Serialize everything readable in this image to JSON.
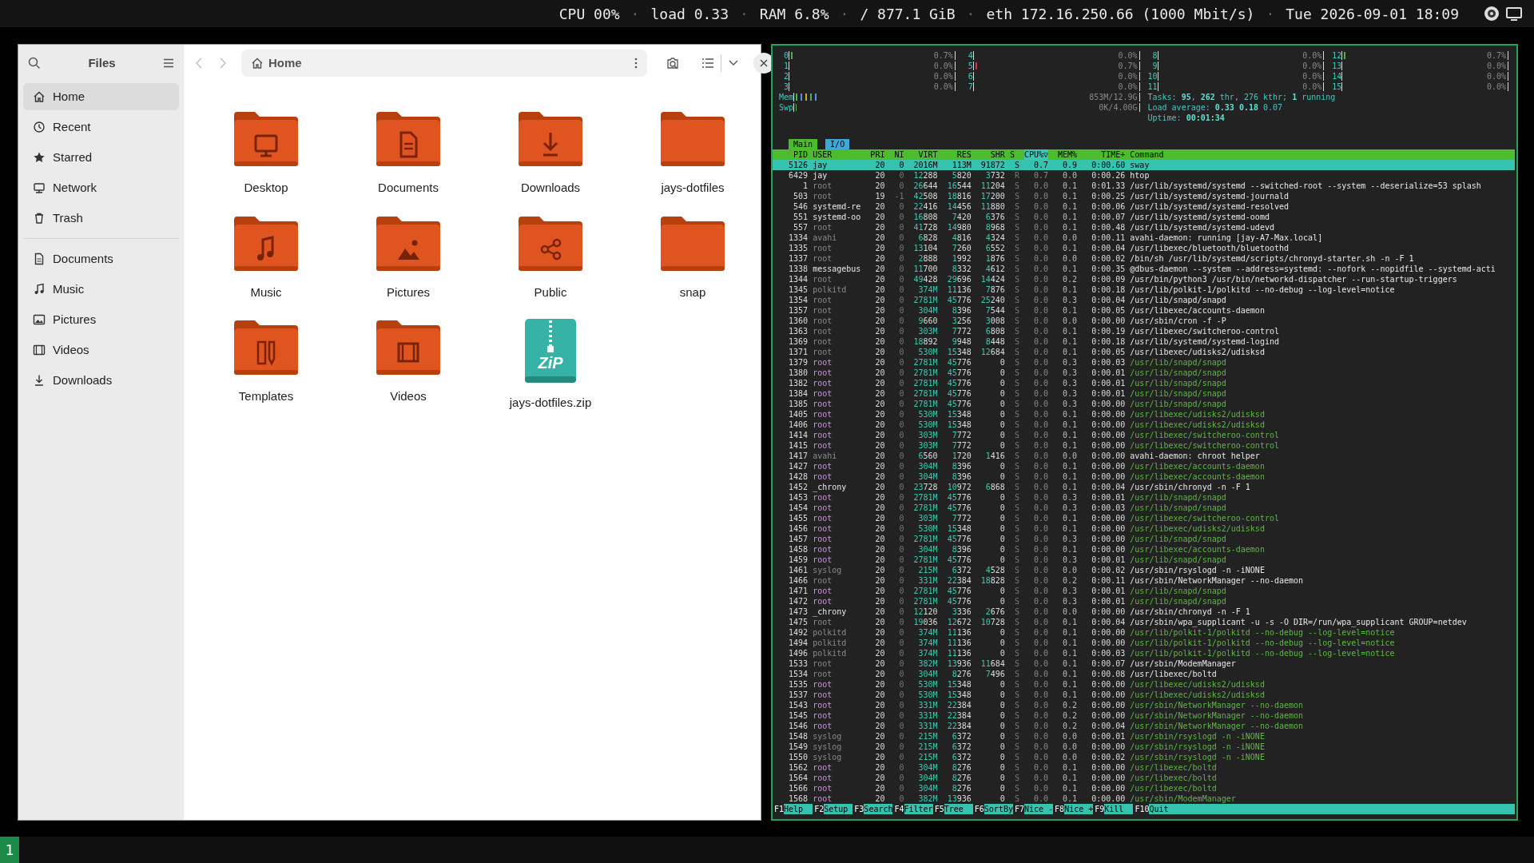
{
  "top_bar": {
    "items": [
      {
        "kind": "stat",
        "text": "CPU 00%"
      },
      {
        "kind": "sep",
        "text": "·"
      },
      {
        "kind": "stat",
        "text": "load 0.33"
      },
      {
        "kind": "sep",
        "text": "·"
      },
      {
        "kind": "stat",
        "text": "RAM 6.8%"
      },
      {
        "kind": "sep",
        "text": "·"
      },
      {
        "kind": "stat",
        "text": "/ 877.1 GiB"
      },
      {
        "kind": "sep",
        "text": "·"
      },
      {
        "kind": "stat",
        "text": "eth 172.16.250.66 (1000 Mbit/s)"
      },
      {
        "kind": "sep",
        "text": "·"
      },
      {
        "kind": "stat",
        "text": "Tue 2026-09-01 18:09"
      }
    ]
  },
  "files": {
    "title": "Files",
    "path": "Home",
    "sidebar": {
      "places": [
        {
          "label": "Home",
          "selected": true
        },
        {
          "label": "Recent",
          "selected": false
        },
        {
          "label": "Starred",
          "selected": false
        },
        {
          "label": "Network",
          "selected": false
        },
        {
          "label": "Trash",
          "selected": false
        }
      ],
      "bookmarks": [
        {
          "label": "Documents",
          "selected": false
        },
        {
          "label": "Music",
          "selected": false
        },
        {
          "label": "Pictures",
          "selected": false
        },
        {
          "label": "Videos",
          "selected": false
        },
        {
          "label": "Downloads",
          "selected": false
        }
      ]
    },
    "items": [
      {
        "label": "Desktop",
        "kind": "folder"
      },
      {
        "label": "Documents",
        "kind": "folder"
      },
      {
        "label": "Downloads",
        "kind": "folder"
      },
      {
        "label": "jays-dotfiles",
        "kind": "folder"
      },
      {
        "label": "Music",
        "kind": "folder"
      },
      {
        "label": "Pictures",
        "kind": "folder"
      },
      {
        "label": "Public",
        "kind": "folder"
      },
      {
        "label": "snap",
        "kind": "folder"
      },
      {
        "label": "Templates",
        "kind": "folder"
      },
      {
        "label": "Videos",
        "kind": "folder"
      },
      {
        "label": "jays-dotfiles.zip",
        "kind": "zip",
        "badge": "ZiP"
      }
    ]
  },
  "htop": {
    "cpus": [
      {
        "label": "0",
        "reading": "0.7%",
        "level": 0.01,
        "color": "#4caf50"
      },
      {
        "label": "4",
        "reading": "0.0%",
        "level": 0
      },
      {
        "label": "8",
        "reading": "0.0%",
        "level": 0
      },
      {
        "label": "12",
        "reading": "0.7%",
        "level": 0.01,
        "color": "#4caf50"
      },
      {
        "label": "1",
        "reading": "0.0%",
        "level": 0
      },
      {
        "label": "5",
        "reading": "0.7%",
        "level": 0.01,
        "color": "#d0304a"
      },
      {
        "label": "9",
        "reading": "0.0%",
        "level": 0
      },
      {
        "label": "13",
        "reading": "0.0%",
        "level": 0
      },
      {
        "label": "2",
        "reading": "0.0%",
        "level": 0
      },
      {
        "label": "6",
        "reading": "0.0%",
        "level": 0
      },
      {
        "label": "10",
        "reading": "0.0%",
        "level": 0
      },
      {
        "label": "14",
        "reading": "0.0%",
        "level": 0
      },
      {
        "label": "3",
        "reading": "0.0%",
        "level": 0
      },
      {
        "label": "7",
        "reading": "0.0%",
        "level": 0
      },
      {
        "label": "11",
        "reading": "0.0%",
        "level": 0
      },
      {
        "label": "15",
        "reading": "0.0%",
        "level": 0
      }
    ],
    "memory": [
      {
        "label": "Mem",
        "reading": "853M/12.9G",
        "level": 0.066
      },
      {
        "label": "Swp",
        "reading": "0K/4.00G",
        "level": 0
      }
    ],
    "summary": [
      "Tasks: **95**, **262** thr, 276 kthr; **1** running",
      "Load average: **0.33** **0.18** 0.07",
      "Uptime: **00:01:34**"
    ],
    "tabs": [
      {
        "label": "Main",
        "selected": true
      },
      {
        "label": "I/O",
        "selected": false
      }
    ],
    "columns": [
      {
        "label": "PID",
        "sorted": false
      },
      {
        "label": "USER",
        "sorted": false
      },
      {
        "label": "PRI",
        "sorted": false
      },
      {
        "label": "NI",
        "sorted": false
      },
      {
        "label": "VIRT",
        "sorted": false
      },
      {
        "label": "RES",
        "sorted": false
      },
      {
        "label": "SHR",
        "sorted": false
      },
      {
        "label": "S",
        "sorted": false
      },
      {
        "label": "CPU%▽",
        "sorted": true
      },
      {
        "label": "MEM%",
        "sorted": false
      },
      {
        "label": "TIME+",
        "sorted": false
      },
      {
        "label": "Command",
        "sorted": false
      }
    ],
    "processes": [
      {
        "kind": "user",
        "selected": true,
        "cells": [
          "5126",
          "jay",
          "20",
          "0",
          "2016M",
          "113M",
          "91872",
          "S",
          "0.7",
          "0.9",
          "0:00.60",
          "sway"
        ]
      },
      {
        "kind": "user",
        "selected": false,
        "cells": [
          "6429",
          "jay",
          "20",
          "0",
          "12288",
          "5820",
          "3732",
          "R",
          "0.7",
          "0.0",
          "0:00.26",
          "htop"
        ]
      },
      {
        "kind": "system",
        "selected": false,
        "cells": [
          "1",
          "root",
          "20",
          "0",
          "26644",
          "16544",
          "11204",
          "S",
          "0.0",
          "0.1",
          "0:01.33",
          "/usr/lib/systemd/systemd --switched-root --system --deserialize=53 splash"
        ]
      },
      {
        "kind": "system",
        "selected": false,
        "cells": [
          "503",
          "root",
          "19",
          "-1",
          "42508",
          "18816",
          "17200",
          "S",
          "0.0",
          "0.1",
          "0:00.25",
          "/usr/lib/systemd/systemd-journald"
        ]
      },
      {
        "kind": "user",
        "selected": false,
        "cells": [
          "546",
          "systemd-re",
          "20",
          "0",
          "22416",
          "14456",
          "11880",
          "S",
          "0.0",
          "0.1",
          "0:00.06",
          "/usr/lib/systemd/systemd-resolved"
        ]
      },
      {
        "kind": "user",
        "selected": false,
        "cells": [
          "551",
          "systemd-oo",
          "20",
          "0",
          "16808",
          "7420",
          "6376",
          "S",
          "0.0",
          "0.1",
          "0:00.07",
          "/usr/lib/systemd/systemd-oomd"
        ]
      },
      {
        "kind": "system",
        "selected": false,
        "cells": [
          "557",
          "root",
          "20",
          "0",
          "41728",
          "14980",
          "8968",
          "S",
          "0.0",
          "0.1",
          "0:00.48",
          "/usr/lib/systemd/systemd-udevd"
        ]
      },
      {
        "kind": "system",
        "selected": false,
        "cells": [
          "1334",
          "avahi",
          "20",
          "0",
          "6828",
          "4816",
          "4324",
          "S",
          "0.0",
          "0.0",
          "0:00.11",
          "avahi-daemon: running [jay-A7-Max.local]"
        ]
      },
      {
        "kind": "system",
        "selected": false,
        "cells": [
          "1335",
          "root",
          "20",
          "0",
          "13104",
          "7260",
          "6552",
          "S",
          "0.0",
          "0.1",
          "0:00.04",
          "/usr/libexec/bluetooth/bluetoothd"
        ]
      },
      {
        "kind": "system",
        "selected": false,
        "cells": [
          "1337",
          "root",
          "20",
          "0",
          "2888",
          "1992",
          "1876",
          "S",
          "0.0",
          "0.0",
          "0:00.02",
          "/bin/sh /usr/lib/systemd/scripts/chronyd-starter.sh -n -F 1"
        ]
      },
      {
        "kind": "user",
        "selected": false,
        "cells": [
          "1338",
          "messagebus",
          "20",
          "0",
          "11700",
          "8332",
          "4612",
          "S",
          "0.0",
          "0.1",
          "0:00.35",
          "@dbus-daemon --system --address=systemd: --nofork --nopidfile --systemd-acti"
        ]
      },
      {
        "kind": "system",
        "selected": false,
        "cells": [
          "1344",
          "root",
          "20",
          "0",
          "49428",
          "29696",
          "14424",
          "S",
          "0.0",
          "0.2",
          "0:00.09",
          "/usr/bin/python3 /usr/bin/networkd-dispatcher --run-startup-triggers"
        ]
      },
      {
        "kind": "system",
        "selected": false,
        "cells": [
          "1345",
          "polkitd",
          "20",
          "0",
          "374M",
          "11136",
          "7876",
          "S",
          "0.0",
          "0.1",
          "0:00.18",
          "/usr/lib/polkit-1/polkitd --no-debug --log-level=notice"
        ]
      },
      {
        "kind": "system",
        "selected": false,
        "cells": [
          "1354",
          "root",
          "20",
          "0",
          "2781M",
          "45776",
          "25240",
          "S",
          "0.0",
          "0.3",
          "0:00.04",
          "/usr/lib/snapd/snapd"
        ]
      },
      {
        "kind": "system",
        "selected": false,
        "cells": [
          "1357",
          "root",
          "20",
          "0",
          "304M",
          "8396",
          "7544",
          "S",
          "0.0",
          "0.1",
          "0:00.05",
          "/usr/libexec/accounts-daemon"
        ]
      },
      {
        "kind": "system",
        "selected": false,
        "cells": [
          "1360",
          "root",
          "20",
          "0",
          "9660",
          "3256",
          "3008",
          "S",
          "0.0",
          "0.0",
          "0:00.00",
          "/usr/sbin/cron -f -P"
        ]
      },
      {
        "kind": "system",
        "selected": false,
        "cells": [
          "1363",
          "root",
          "20",
          "0",
          "303M",
          "7772",
          "6808",
          "S",
          "0.0",
          "0.1",
          "0:00.19",
          "/usr/libexec/switcheroo-control"
        ]
      },
      {
        "kind": "system",
        "selected": false,
        "cells": [
          "1369",
          "root",
          "20",
          "0",
          "18892",
          "9948",
          "8448",
          "S",
          "0.0",
          "0.1",
          "0:00.18",
          "/usr/lib/systemd/systemd-logind"
        ]
      },
      {
        "kind": "system",
        "selected": false,
        "cells": [
          "1371",
          "root",
          "20",
          "0",
          "530M",
          "15348",
          "12684",
          "S",
          "0.0",
          "0.1",
          "0:00.05",
          "/usr/libexec/udisks2/udisksd"
        ]
      },
      {
        "kind": "thread",
        "selected": false,
        "cells": [
          "1379",
          "root",
          "20",
          "0",
          "2781M",
          "45776",
          "0",
          "S",
          "0.0",
          "0.3",
          "0:00.03",
          "/usr/lib/snapd/snapd"
        ]
      },
      {
        "kind": "thread",
        "selected": false,
        "cells": [
          "1380",
          "root",
          "20",
          "0",
          "2781M",
          "45776",
          "0",
          "S",
          "0.0",
          "0.3",
          "0:00.01",
          "/usr/lib/snapd/snapd"
        ]
      },
      {
        "kind": "thread",
        "selected": false,
        "cells": [
          "1382",
          "root",
          "20",
          "0",
          "2781M",
          "45776",
          "0",
          "S",
          "0.0",
          "0.3",
          "0:00.01",
          "/usr/lib/snapd/snapd"
        ]
      },
      {
        "kind": "thread",
        "selected": false,
        "cells": [
          "1384",
          "root",
          "20",
          "0",
          "2781M",
          "45776",
          "0",
          "S",
          "0.0",
          "0.3",
          "0:00.01",
          "/usr/lib/snapd/snapd"
        ]
      },
      {
        "kind": "thread",
        "selected": false,
        "cells": [
          "1385",
          "root",
          "20",
          "0",
          "2781M",
          "45776",
          "0",
          "S",
          "0.0",
          "0.3",
          "0:00.00",
          "/usr/lib/snapd/snapd"
        ]
      },
      {
        "kind": "thread",
        "selected": false,
        "cells": [
          "1405",
          "root",
          "20",
          "0",
          "530M",
          "15348",
          "0",
          "S",
          "0.0",
          "0.1",
          "0:00.00",
          "/usr/libexec/udisks2/udisksd"
        ]
      },
      {
        "kind": "thread",
        "selected": false,
        "cells": [
          "1406",
          "root",
          "20",
          "0",
          "530M",
          "15348",
          "0",
          "S",
          "0.0",
          "0.1",
          "0:00.00",
          "/usr/libexec/udisks2/udisksd"
        ]
      },
      {
        "kind": "thread",
        "selected": false,
        "cells": [
          "1414",
          "root",
          "20",
          "0",
          "303M",
          "7772",
          "0",
          "S",
          "0.0",
          "0.1",
          "0:00.00",
          "/usr/libexec/switcheroo-control"
        ]
      },
      {
        "kind": "thread",
        "selected": false,
        "cells": [
          "1415",
          "root",
          "20",
          "0",
          "303M",
          "7772",
          "0",
          "S",
          "0.0",
          "0.1",
          "0:00.00",
          "/usr/libexec/switcheroo-control"
        ]
      },
      {
        "kind": "system",
        "selected": false,
        "cells": [
          "1417",
          "avahi",
          "20",
          "0",
          "6560",
          "1720",
          "1416",
          "S",
          "0.0",
          "0.0",
          "0:00.00",
          "avahi-daemon: chroot helper"
        ]
      },
      {
        "kind": "thread",
        "selected": false,
        "cells": [
          "1427",
          "root",
          "20",
          "0",
          "304M",
          "8396",
          "0",
          "S",
          "0.0",
          "0.1",
          "0:00.00",
          "/usr/libexec/accounts-daemon"
        ]
      },
      {
        "kind": "thread",
        "selected": false,
        "cells": [
          "1428",
          "root",
          "20",
          "0",
          "304M",
          "8396",
          "0",
          "S",
          "0.0",
          "0.1",
          "0:00.00",
          "/usr/libexec/accounts-daemon"
        ]
      },
      {
        "kind": "user",
        "selected": false,
        "cells": [
          "1452",
          "_chrony",
          "20",
          "0",
          "23728",
          "10972",
          "6868",
          "S",
          "0.0",
          "0.1",
          "0:00.04",
          "/usr/sbin/chronyd -n -F 1"
        ]
      },
      {
        "kind": "thread",
        "selected": false,
        "cells": [
          "1453",
          "root",
          "20",
          "0",
          "2781M",
          "45776",
          "0",
          "S",
          "0.0",
          "0.3",
          "0:00.01",
          "/usr/lib/snapd/snapd"
        ]
      },
      {
        "kind": "thread",
        "selected": false,
        "cells": [
          "1454",
          "root",
          "20",
          "0",
          "2781M",
          "45776",
          "0",
          "S",
          "0.0",
          "0.3",
          "0:00.03",
          "/usr/lib/snapd/snapd"
        ]
      },
      {
        "kind": "thread",
        "selected": false,
        "cells": [
          "1455",
          "root",
          "20",
          "0",
          "303M",
          "7772",
          "0",
          "S",
          "0.0",
          "0.1",
          "0:00.00",
          "/usr/libexec/switcheroo-control"
        ]
      },
      {
        "kind": "thread",
        "selected": false,
        "cells": [
          "1456",
          "root",
          "20",
          "0",
          "530M",
          "15348",
          "0",
          "S",
          "0.0",
          "0.1",
          "0:00.00",
          "/usr/libexec/udisks2/udisksd"
        ]
      },
      {
        "kind": "thread",
        "selected": false,
        "cells": [
          "1457",
          "root",
          "20",
          "0",
          "2781M",
          "45776",
          "0",
          "S",
          "0.0",
          "0.3",
          "0:00.00",
          "/usr/lib/snapd/snapd"
        ]
      },
      {
        "kind": "thread",
        "selected": false,
        "cells": [
          "1458",
          "root",
          "20",
          "0",
          "304M",
          "8396",
          "0",
          "S",
          "0.0",
          "0.1",
          "0:00.00",
          "/usr/libexec/accounts-daemon"
        ]
      },
      {
        "kind": "thread",
        "selected": false,
        "cells": [
          "1459",
          "root",
          "20",
          "0",
          "2781M",
          "45776",
          "0",
          "S",
          "0.0",
          "0.3",
          "0:00.01",
          "/usr/lib/snapd/snapd"
        ]
      },
      {
        "kind": "system",
        "selected": false,
        "cells": [
          "1461",
          "syslog",
          "20",
          "0",
          "215M",
          "6372",
          "4528",
          "S",
          "0.0",
          "0.0",
          "0:00.02",
          "/usr/sbin/rsyslogd -n -iNONE"
        ]
      },
      {
        "kind": "system",
        "selected": false,
        "cells": [
          "1466",
          "root",
          "20",
          "0",
          "331M",
          "22384",
          "18828",
          "S",
          "0.0",
          "0.2",
          "0:00.11",
          "/usr/sbin/NetworkManager --no-daemon"
        ]
      },
      {
        "kind": "thread",
        "selected": false,
        "cells": [
          "1471",
          "root",
          "20",
          "0",
          "2781M",
          "45776",
          "0",
          "S",
          "0.0",
          "0.3",
          "0:00.01",
          "/usr/lib/snapd/snapd"
        ]
      },
      {
        "kind": "thread",
        "selected": false,
        "cells": [
          "1472",
          "root",
          "20",
          "0",
          "2781M",
          "45776",
          "0",
          "S",
          "0.0",
          "0.3",
          "0:00.01",
          "/usr/lib/snapd/snapd"
        ]
      },
      {
        "kind": "user",
        "selected": false,
        "cells": [
          "1473",
          "_chrony",
          "20",
          "0",
          "12120",
          "3336",
          "2676",
          "S",
          "0.0",
          "0.0",
          "0:00.00",
          "/usr/sbin/chronyd -n -F 1"
        ]
      },
      {
        "kind": "system",
        "selected": false,
        "cells": [
          "1475",
          "root",
          "20",
          "0",
          "19036",
          "12672",
          "10728",
          "S",
          "0.0",
          "0.1",
          "0:00.04",
          "/usr/sbin/wpa_supplicant -u -s -O DIR=/run/wpa_supplicant GROUP=netdev"
        ]
      },
      {
        "kind": "thread-dim",
        "selected": false,
        "cells": [
          "1492",
          "polkitd",
          "20",
          "0",
          "374M",
          "11136",
          "0",
          "S",
          "0.0",
          "0.1",
          "0:00.00",
          "/usr/lib/polkit-1/polkitd --no-debug --log-level=notice"
        ]
      },
      {
        "kind": "thread-dim",
        "selected": false,
        "cells": [
          "1494",
          "polkitd",
          "20",
          "0",
          "374M",
          "11136",
          "0",
          "S",
          "0.0",
          "0.1",
          "0:00.00",
          "/usr/lib/polkit-1/polkitd --no-debug --log-level=notice"
        ]
      },
      {
        "kind": "thread-dim",
        "selected": false,
        "cells": [
          "1496",
          "polkitd",
          "20",
          "0",
          "374M",
          "11136",
          "0",
          "S",
          "0.0",
          "0.1",
          "0:00.03",
          "/usr/lib/polkit-1/polkitd --no-debug --log-level=notice"
        ]
      },
      {
        "kind": "system",
        "selected": false,
        "cells": [
          "1533",
          "root",
          "20",
          "0",
          "382M",
          "13936",
          "11684",
          "S",
          "0.0",
          "0.1",
          "0:00.07",
          "/usr/sbin/ModemManager"
        ]
      },
      {
        "kind": "system",
        "selected": false,
        "cells": [
          "1534",
          "root",
          "20",
          "0",
          "304M",
          "8276",
          "7496",
          "S",
          "0.0",
          "0.1",
          "0:00.08",
          "/usr/libexec/boltd"
        ]
      },
      {
        "kind": "thread",
        "selected": false,
        "cells": [
          "1535",
          "root",
          "20",
          "0",
          "530M",
          "15348",
          "0",
          "S",
          "0.0",
          "0.1",
          "0:00.00",
          "/usr/libexec/udisks2/udisksd"
        ]
      },
      {
        "kind": "thread",
        "selected": false,
        "cells": [
          "1537",
          "root",
          "20",
          "0",
          "530M",
          "15348",
          "0",
          "S",
          "0.0",
          "0.1",
          "0:00.00",
          "/usr/libexec/udisks2/udisksd"
        ]
      },
      {
        "kind": "thread",
        "selected": false,
        "cells": [
          "1543",
          "root",
          "20",
          "0",
          "331M",
          "22384",
          "0",
          "S",
          "0.0",
          "0.2",
          "0:00.00",
          "/usr/sbin/NetworkManager --no-daemon"
        ]
      },
      {
        "kind": "thread",
        "selected": false,
        "cells": [
          "1545",
          "root",
          "20",
          "0",
          "331M",
          "22384",
          "0",
          "S",
          "0.0",
          "0.2",
          "0:00.00",
          "/usr/sbin/NetworkManager --no-daemon"
        ]
      },
      {
        "kind": "thread",
        "selected": false,
        "cells": [
          "1546",
          "root",
          "20",
          "0",
          "331M",
          "22384",
          "0",
          "S",
          "0.0",
          "0.2",
          "0:00.04",
          "/usr/sbin/NetworkManager --no-daemon"
        ]
      },
      {
        "kind": "thread-dim",
        "selected": false,
        "cells": [
          "1548",
          "syslog",
          "20",
          "0",
          "215M",
          "6372",
          "0",
          "S",
          "0.0",
          "0.0",
          "0:00.01",
          "/usr/sbin/rsyslogd -n -iNONE"
        ]
      },
      {
        "kind": "thread-dim",
        "selected": false,
        "cells": [
          "1549",
          "syslog",
          "20",
          "0",
          "215M",
          "6372",
          "0",
          "S",
          "0.0",
          "0.0",
          "0:00.00",
          "/usr/sbin/rsyslogd -n -iNONE"
        ]
      },
      {
        "kind": "thread-dim",
        "selected": false,
        "cells": [
          "1550",
          "syslog",
          "20",
          "0",
          "215M",
          "6372",
          "0",
          "S",
          "0.0",
          "0.0",
          "0:00.02",
          "/usr/sbin/rsyslogd -n -iNONE"
        ]
      },
      {
        "kind": "thread",
        "selected": false,
        "cells": [
          "1562",
          "root",
          "20",
          "0",
          "304M",
          "8276",
          "0",
          "S",
          "0.0",
          "0.1",
          "0:00.00",
          "/usr/libexec/boltd"
        ]
      },
      {
        "kind": "thread",
        "selected": false,
        "cells": [
          "1564",
          "root",
          "20",
          "0",
          "304M",
          "8276",
          "0",
          "S",
          "0.0",
          "0.1",
          "0:00.00",
          "/usr/libexec/boltd"
        ]
      },
      {
        "kind": "thread",
        "selected": false,
        "cells": [
          "1566",
          "root",
          "20",
          "0",
          "304M",
          "8276",
          "0",
          "S",
          "0.0",
          "0.1",
          "0:00.00",
          "/usr/libexec/boltd"
        ]
      },
      {
        "kind": "thread",
        "selected": false,
        "cells": [
          "1568",
          "root",
          "20",
          "0",
          "382M",
          "13936",
          "0",
          "S",
          "0.0",
          "0.1",
          "0:00.00",
          "/usr/sbin/ModemManager"
        ]
      }
    ],
    "function_keys": [
      {
        "key": "F1",
        "label": "Help"
      },
      {
        "key": "F2",
        "label": "Setup"
      },
      {
        "key": "F3",
        "label": "Search"
      },
      {
        "key": "F4",
        "label": "Filter"
      },
      {
        "key": "F5",
        "label": "Tree"
      },
      {
        "key": "F6",
        "label": "SortBy"
      },
      {
        "key": "F7",
        "label": "Nice -"
      },
      {
        "key": "F8",
        "label": "Nice +"
      },
      {
        "key": "F9",
        "label": "Kill"
      },
      {
        "key": "F10",
        "label": "Quit"
      }
    ]
  },
  "workspaces": [
    {
      "label": "1",
      "selected": true
    }
  ]
}
